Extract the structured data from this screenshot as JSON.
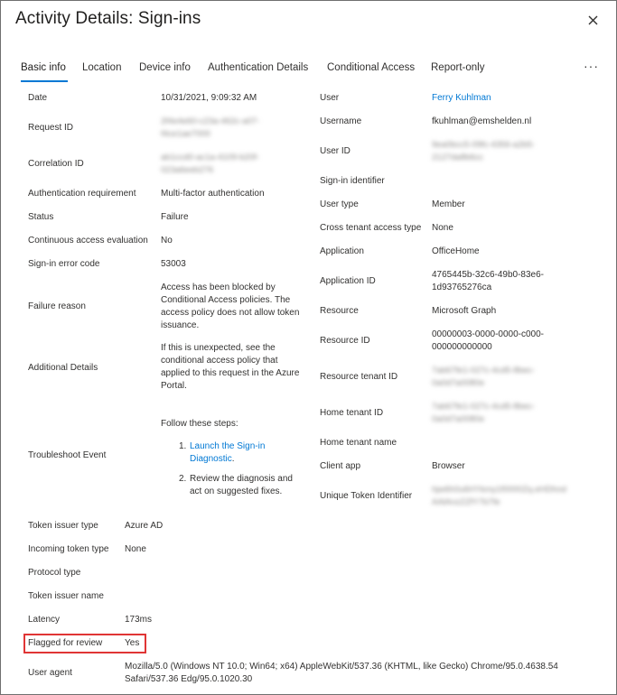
{
  "dialog": {
    "title": "Activity Details: Sign-ins",
    "close_icon": "close-icon",
    "more_icon": "more-options-icon"
  },
  "tabs": [
    {
      "label": "Basic info",
      "active": true
    },
    {
      "label": "Location"
    },
    {
      "label": "Device info"
    },
    {
      "label": "Authentication Details"
    },
    {
      "label": "Conditional Access"
    },
    {
      "label": "Report-only"
    }
  ],
  "more_label": "···",
  "left": {
    "date": {
      "label": "Date",
      "value": "10/31/2021, 9:09:32 AM"
    },
    "request_id": {
      "label": "Request ID",
      "value_line1": "2f4e4e60-c23a-462c-a07-",
      "value_line2": "f4ce1ae7000"
    },
    "correlation_id": {
      "label": "Correlation ID",
      "value_line1": "ab1ccd0-ac1a-4109-b20f-",
      "value_line2": "023a6eeb276"
    },
    "auth_requirement": {
      "label": "Authentication requirement",
      "value": "Multi-factor authentication"
    },
    "status": {
      "label": "Status",
      "value": "Failure"
    },
    "continuous_access": {
      "label": "Continuous access evaluation",
      "value": "No"
    },
    "error_code": {
      "label": "Sign-in error code",
      "value": "53003"
    },
    "failure_reason": {
      "label": "Failure reason",
      "value": "Access has been blocked by Conditional Access policies. The access policy does not allow token issuance."
    },
    "additional_details": {
      "label": "Additional Details",
      "value": "If this is unexpected, see the conditional access policy that applied to this request in the Azure Portal."
    },
    "troubleshoot": {
      "label": "Troubleshoot Event",
      "intro": "Follow these steps:",
      "step1_num": "1.",
      "step1_link": "Launch the Sign-in Diagnostic",
      "step1_tail": ".",
      "step2_num": "2.",
      "step2_text": "Review the diagnosis and act on suggested fixes."
    }
  },
  "right": {
    "user": {
      "label": "User",
      "value": "Ferry Kuhlman"
    },
    "username": {
      "label": "Username",
      "value": "fkuhlman@emshelden.nl"
    },
    "user_id": {
      "label": "User ID",
      "value_line1": "9ea0bcc5-09fc-4356-a2b5-",
      "value_line2": "2127da8b6cc"
    },
    "signin_identifier": {
      "label": "Sign-in identifier",
      "value": ""
    },
    "user_type": {
      "label": "User type",
      "value": "Member"
    },
    "cross_tenant": {
      "label": "Cross tenant access type",
      "value": "None"
    },
    "application": {
      "label": "Application",
      "value": "OfficeHome"
    },
    "application_id": {
      "label": "Application ID",
      "value_line1": "4765445b-32c6-49b0-83e6-",
      "value_line2": "1d93765276ca"
    },
    "resource": {
      "label": "Resource",
      "value": "Microsoft Graph"
    },
    "resource_id": {
      "label": "Resource ID",
      "value_line1": "00000003-0000-0000-c000-",
      "value_line2": "000000000000"
    },
    "resource_tenant_id": {
      "label": "Resource tenant ID",
      "value_line1": "7ab67fe1-027c-4cd5-8bec-",
      "value_line2": "0a0d7a0080e"
    },
    "home_tenant_id": {
      "label": "Home tenant ID",
      "value_line1": "7ab67fe1-027c-4cd5-8bec-",
      "value_line2": "0a0d7a0080e"
    },
    "home_tenant_name": {
      "label": "Home tenant name",
      "value": ""
    },
    "client_app": {
      "label": "Client app",
      "value": "Browser"
    },
    "unique_token": {
      "label": "Unique Token Identifier",
      "value_line1": "hjw6h0u6HYkmy1f0000Zq.eHDhnd",
      "value_line2": "AAlAnzZZfY7b7fe"
    }
  },
  "bottom": {
    "token_issuer_type": {
      "label": "Token issuer type",
      "value": "Azure AD"
    },
    "incoming_token_type": {
      "label": "Incoming token type",
      "value": "None"
    },
    "protocol_type": {
      "label": "Protocol type",
      "value": ""
    },
    "token_issuer_name": {
      "label": "Token issuer name",
      "value": ""
    },
    "latency": {
      "label": "Latency",
      "value": "173ms"
    },
    "flagged": {
      "label": "Flagged for review",
      "value": "Yes"
    },
    "user_agent": {
      "label": "User agent",
      "value_line1": "Mozilla/5.0 (Windows NT 10.0; Win64; x64) AppleWebKit/537.36 (KHTML, like Gecko) Chrome/95.0.4638.54",
      "value_line2": "Safari/537.36 Edg/95.0.1020.30"
    }
  },
  "colors": {
    "accent": "#0078d4",
    "highlight": "#e03535",
    "text": "#323130"
  }
}
